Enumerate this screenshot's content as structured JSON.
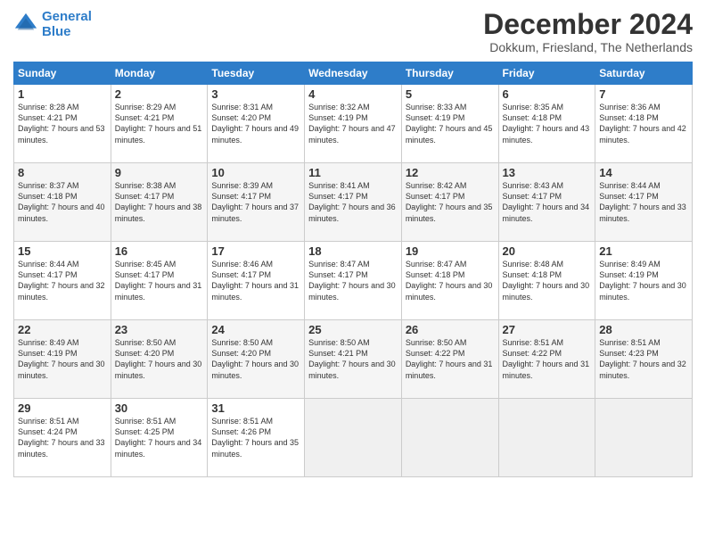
{
  "logo": {
    "line1": "General",
    "line2": "Blue"
  },
  "title": "December 2024",
  "subtitle": "Dokkum, Friesland, The Netherlands",
  "headers": [
    "Sunday",
    "Monday",
    "Tuesday",
    "Wednesday",
    "Thursday",
    "Friday",
    "Saturday"
  ],
  "weeks": [
    [
      {
        "day": "1",
        "sunrise": "Sunrise: 8:28 AM",
        "sunset": "Sunset: 4:21 PM",
        "daylight": "Daylight: 7 hours and 53 minutes."
      },
      {
        "day": "2",
        "sunrise": "Sunrise: 8:29 AM",
        "sunset": "Sunset: 4:21 PM",
        "daylight": "Daylight: 7 hours and 51 minutes."
      },
      {
        "day": "3",
        "sunrise": "Sunrise: 8:31 AM",
        "sunset": "Sunset: 4:20 PM",
        "daylight": "Daylight: 7 hours and 49 minutes."
      },
      {
        "day": "4",
        "sunrise": "Sunrise: 8:32 AM",
        "sunset": "Sunset: 4:19 PM",
        "daylight": "Daylight: 7 hours and 47 minutes."
      },
      {
        "day": "5",
        "sunrise": "Sunrise: 8:33 AM",
        "sunset": "Sunset: 4:19 PM",
        "daylight": "Daylight: 7 hours and 45 minutes."
      },
      {
        "day": "6",
        "sunrise": "Sunrise: 8:35 AM",
        "sunset": "Sunset: 4:18 PM",
        "daylight": "Daylight: 7 hours and 43 minutes."
      },
      {
        "day": "7",
        "sunrise": "Sunrise: 8:36 AM",
        "sunset": "Sunset: 4:18 PM",
        "daylight": "Daylight: 7 hours and 42 minutes."
      }
    ],
    [
      {
        "day": "8",
        "sunrise": "Sunrise: 8:37 AM",
        "sunset": "Sunset: 4:18 PM",
        "daylight": "Daylight: 7 hours and 40 minutes."
      },
      {
        "day": "9",
        "sunrise": "Sunrise: 8:38 AM",
        "sunset": "Sunset: 4:17 PM",
        "daylight": "Daylight: 7 hours and 38 minutes."
      },
      {
        "day": "10",
        "sunrise": "Sunrise: 8:39 AM",
        "sunset": "Sunset: 4:17 PM",
        "daylight": "Daylight: 7 hours and 37 minutes."
      },
      {
        "day": "11",
        "sunrise": "Sunrise: 8:41 AM",
        "sunset": "Sunset: 4:17 PM",
        "daylight": "Daylight: 7 hours and 36 minutes."
      },
      {
        "day": "12",
        "sunrise": "Sunrise: 8:42 AM",
        "sunset": "Sunset: 4:17 PM",
        "daylight": "Daylight: 7 hours and 35 minutes."
      },
      {
        "day": "13",
        "sunrise": "Sunrise: 8:43 AM",
        "sunset": "Sunset: 4:17 PM",
        "daylight": "Daylight: 7 hours and 34 minutes."
      },
      {
        "day": "14",
        "sunrise": "Sunrise: 8:44 AM",
        "sunset": "Sunset: 4:17 PM",
        "daylight": "Daylight: 7 hours and 33 minutes."
      }
    ],
    [
      {
        "day": "15",
        "sunrise": "Sunrise: 8:44 AM",
        "sunset": "Sunset: 4:17 PM",
        "daylight": "Daylight: 7 hours and 32 minutes."
      },
      {
        "day": "16",
        "sunrise": "Sunrise: 8:45 AM",
        "sunset": "Sunset: 4:17 PM",
        "daylight": "Daylight: 7 hours and 31 minutes."
      },
      {
        "day": "17",
        "sunrise": "Sunrise: 8:46 AM",
        "sunset": "Sunset: 4:17 PM",
        "daylight": "Daylight: 7 hours and 31 minutes."
      },
      {
        "day": "18",
        "sunrise": "Sunrise: 8:47 AM",
        "sunset": "Sunset: 4:17 PM",
        "daylight": "Daylight: 7 hours and 30 minutes."
      },
      {
        "day": "19",
        "sunrise": "Sunrise: 8:47 AM",
        "sunset": "Sunset: 4:18 PM",
        "daylight": "Daylight: 7 hours and 30 minutes."
      },
      {
        "day": "20",
        "sunrise": "Sunrise: 8:48 AM",
        "sunset": "Sunset: 4:18 PM",
        "daylight": "Daylight: 7 hours and 30 minutes."
      },
      {
        "day": "21",
        "sunrise": "Sunrise: 8:49 AM",
        "sunset": "Sunset: 4:19 PM",
        "daylight": "Daylight: 7 hours and 30 minutes."
      }
    ],
    [
      {
        "day": "22",
        "sunrise": "Sunrise: 8:49 AM",
        "sunset": "Sunset: 4:19 PM",
        "daylight": "Daylight: 7 hours and 30 minutes."
      },
      {
        "day": "23",
        "sunrise": "Sunrise: 8:50 AM",
        "sunset": "Sunset: 4:20 PM",
        "daylight": "Daylight: 7 hours and 30 minutes."
      },
      {
        "day": "24",
        "sunrise": "Sunrise: 8:50 AM",
        "sunset": "Sunset: 4:20 PM",
        "daylight": "Daylight: 7 hours and 30 minutes."
      },
      {
        "day": "25",
        "sunrise": "Sunrise: 8:50 AM",
        "sunset": "Sunset: 4:21 PM",
        "daylight": "Daylight: 7 hours and 30 minutes."
      },
      {
        "day": "26",
        "sunrise": "Sunrise: 8:50 AM",
        "sunset": "Sunset: 4:22 PM",
        "daylight": "Daylight: 7 hours and 31 minutes."
      },
      {
        "day": "27",
        "sunrise": "Sunrise: 8:51 AM",
        "sunset": "Sunset: 4:22 PM",
        "daylight": "Daylight: 7 hours and 31 minutes."
      },
      {
        "day": "28",
        "sunrise": "Sunrise: 8:51 AM",
        "sunset": "Sunset: 4:23 PM",
        "daylight": "Daylight: 7 hours and 32 minutes."
      }
    ],
    [
      {
        "day": "29",
        "sunrise": "Sunrise: 8:51 AM",
        "sunset": "Sunset: 4:24 PM",
        "daylight": "Daylight: 7 hours and 33 minutes."
      },
      {
        "day": "30",
        "sunrise": "Sunrise: 8:51 AM",
        "sunset": "Sunset: 4:25 PM",
        "daylight": "Daylight: 7 hours and 34 minutes."
      },
      {
        "day": "31",
        "sunrise": "Sunrise: 8:51 AM",
        "sunset": "Sunset: 4:26 PM",
        "daylight": "Daylight: 7 hours and 35 minutes."
      },
      null,
      null,
      null,
      null
    ]
  ]
}
